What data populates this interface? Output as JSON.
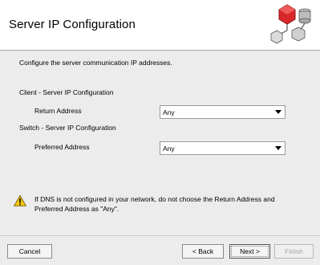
{
  "header": {
    "title": "Server IP Configuration",
    "logo_icon": "network-cubes-icon",
    "accent_color": "#d8282a"
  },
  "main": {
    "description": "Configure the server communication IP addresses.",
    "client_section": {
      "heading": "Client - Server IP Configuration",
      "label": "Return Address",
      "selected": "Any"
    },
    "switch_section": {
      "heading": "Switch - Server IP Configuration",
      "label": "Preferred Address",
      "selected": "Any"
    },
    "warning": {
      "icon": "warning-icon",
      "line1": "If DNS is not configured in your network, do not choose the Return Address and",
      "line2": "Preferred Address as \"Any\"."
    }
  },
  "footer": {
    "cancel_label": "Cancel",
    "back_label": "< Back",
    "next_label": "Next >",
    "finish_label": "Finish"
  }
}
